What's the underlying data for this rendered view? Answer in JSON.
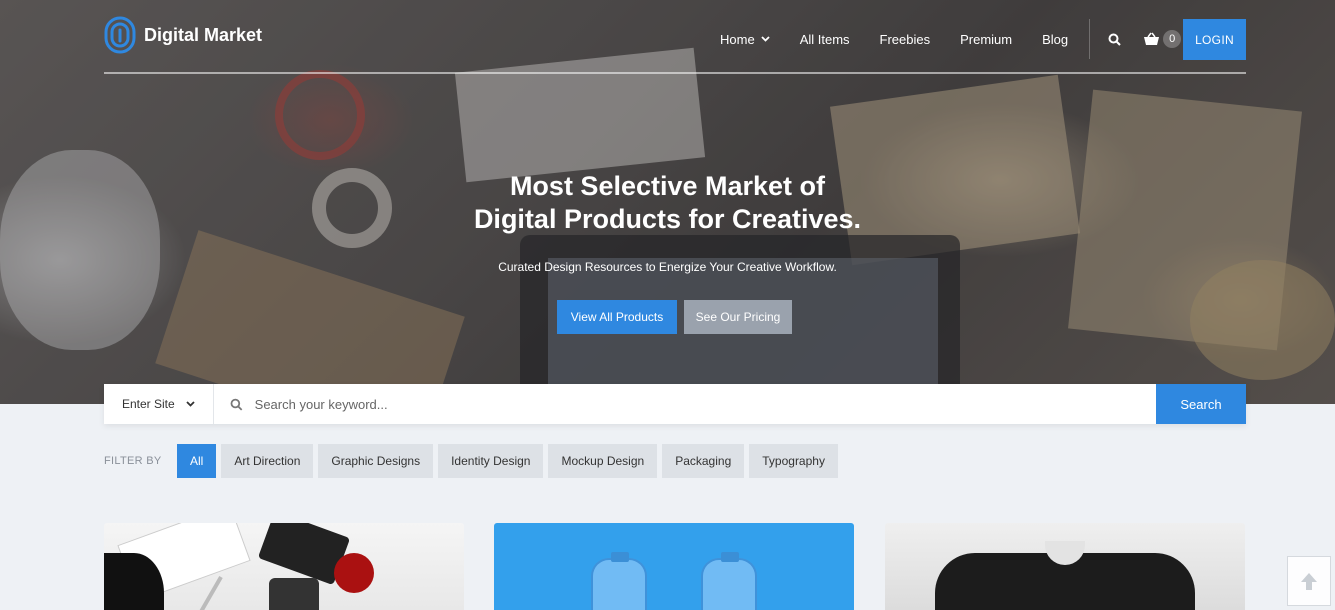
{
  "brand": {
    "name": "Digital Market",
    "accent": "#2f88e0"
  },
  "nav": {
    "items": [
      {
        "label": "Home",
        "has_dropdown": true
      },
      {
        "label": "All Items"
      },
      {
        "label": "Freebies"
      },
      {
        "label": "Premium"
      },
      {
        "label": "Blog"
      }
    ],
    "search_icon": "search-icon",
    "cart_icon": "basket-icon",
    "cart_count": "0",
    "login_label": "LOGIN"
  },
  "hero": {
    "title_line1": "Most Selective Market of",
    "title_line2": "Digital Products for Creatives.",
    "subtitle": "Curated Design Resources to Energize Your Creative Workflow.",
    "primary_button": "View All Products",
    "secondary_button": "See Our Pricing"
  },
  "search": {
    "site_select_value": "Enter Site",
    "placeholder": "Search your keyword...",
    "button_label": "Search"
  },
  "filters": {
    "label": "FILTER BY",
    "items": [
      "All",
      "Art Direction",
      "Graphic Designs",
      "Identity Design",
      "Mockup Design",
      "Packaging",
      "Typography"
    ],
    "active": "All"
  },
  "back_to_top_icon": "arrow-up-icon"
}
